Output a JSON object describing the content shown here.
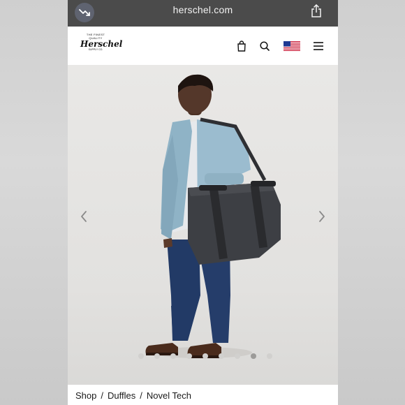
{
  "browser": {
    "url": "herschel.com"
  },
  "header": {
    "logo": {
      "line1": "THE FINEST QUALITY",
      "script": "Herschel",
      "line2": "SUPPLY CO."
    }
  },
  "hero": {
    "slide_count": 9,
    "active_slide": 8
  },
  "breadcrumb": {
    "items": [
      "Shop",
      "Duffles",
      "Novel Tech"
    ],
    "separator": "/"
  }
}
